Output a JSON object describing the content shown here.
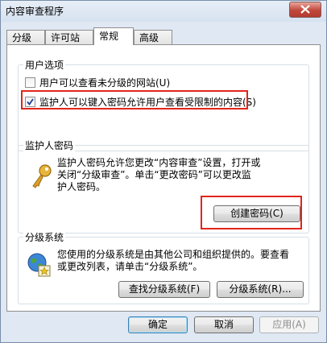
{
  "window": {
    "title": "内容审查程序"
  },
  "tabs": [
    {
      "label": "分级"
    },
    {
      "label": "许可站点"
    },
    {
      "label": "常规"
    },
    {
      "label": "高级"
    }
  ],
  "user_options": {
    "legend": "用户选项",
    "option1": "用户可以查看未分级的网站(U)",
    "option2": "监护人可以键入密码允许用户查看受限制的内容(S)"
  },
  "supervisor_password": {
    "legend": "监护人密码",
    "description_line1": "监护人密码允许您更改“内容审查”设置，打开或",
    "description_line2": "关闭“分级审查”。单击“更改密码”可以更改监",
    "description_line3": "护人密码。",
    "create_button": "创建密码(C)"
  },
  "rating_systems": {
    "legend": "分级系统",
    "description_line1": "您使用的分级系统是由其他公司和组织提供的。要查看",
    "description_line2": "或更改列表，请单击“分级系统”。",
    "find_button": "查找分级系统(F)",
    "systems_button": "分级系统(R)..."
  },
  "footer": {
    "ok": "确定",
    "cancel": "取消",
    "apply": "应用(A)"
  }
}
